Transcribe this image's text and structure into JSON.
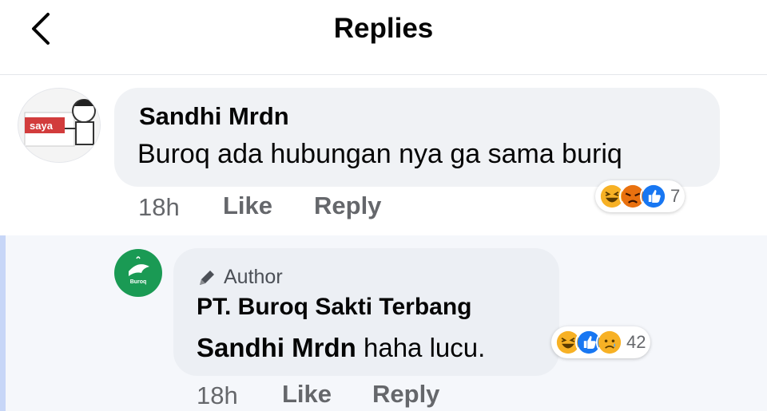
{
  "header": {
    "title": "Replies",
    "back_icon": "chevron-left-icon"
  },
  "comment": {
    "author": "Sandhi Mrdn",
    "avatar_sign_text": "saya",
    "text": "Buroq ada hubungan nya ga sama buriq",
    "time": "18h",
    "like_label": "Like",
    "reply_label": "Reply",
    "reactions": [
      "haha-icon",
      "angry-icon",
      "like-icon"
    ],
    "reaction_count": "7"
  },
  "reply": {
    "author_badge_label": "Author",
    "author_badge_icon": "pencil-icon",
    "author": "PT. Buroq Sakti Terbang",
    "avatar_text": "Buroq",
    "mention": "Sandhi Mrdn",
    "text": " haha lucu.",
    "time": "18h",
    "like_label": "Like",
    "reply_label": "Reply",
    "reactions": [
      "haha-icon",
      "like-icon",
      "sad-icon"
    ],
    "reaction_count": "42"
  },
  "colors": {
    "like_blue": "#1877f2",
    "haha_yellow": "#f7b125",
    "angry_orange": "#e9710f",
    "brand_green": "#1a9a54"
  }
}
